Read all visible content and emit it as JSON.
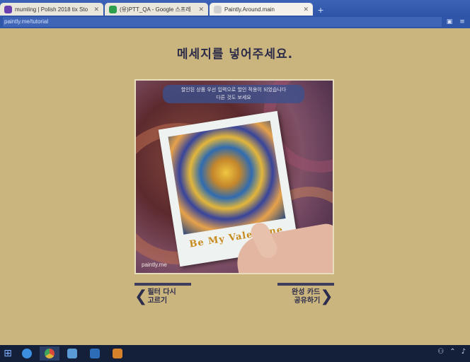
{
  "browser": {
    "tabs": [
      {
        "title": "mumling | Polish 2018 tix Sto",
        "active": false,
        "favicon_color": "#6a3fb0"
      },
      {
        "title": "(유)PTT_QA - Google 스프레",
        "active": false,
        "favicon_color": "#2e9e4f"
      },
      {
        "title": "Paintly.Around.main",
        "active": true,
        "favicon_color": "#d0d0d0"
      }
    ],
    "new_tab_label": "+",
    "address": "paintly.me/tutorial"
  },
  "page": {
    "heading": "메세지를 넣어주세요.",
    "photo": {
      "message_line1": "할인된 상품 우선 입력으로 할인 적용이 되었습니다",
      "message_line2": "다른 것도 보세요",
      "caption": "Be My Valentine",
      "watermark": "paintly.me"
    },
    "nav": {
      "prev_line1": "필터 다시",
      "prev_line2": "고르기",
      "next_line1": "완성 카드",
      "next_line2": "공유하기"
    }
  },
  "taskbar": {
    "apps": [
      {
        "name": "ie-icon",
        "color": "#3b8ee0",
        "active": false
      },
      {
        "name": "chrome-icon",
        "color": "#e0b43b",
        "active": true
      },
      {
        "name": "explorer-icon",
        "color": "#5b9bd5",
        "active": false
      },
      {
        "name": "photoshop-icon",
        "color": "#2d6db8",
        "active": false
      },
      {
        "name": "illustrator-icon",
        "color": "#d6822a",
        "active": false
      }
    ]
  }
}
